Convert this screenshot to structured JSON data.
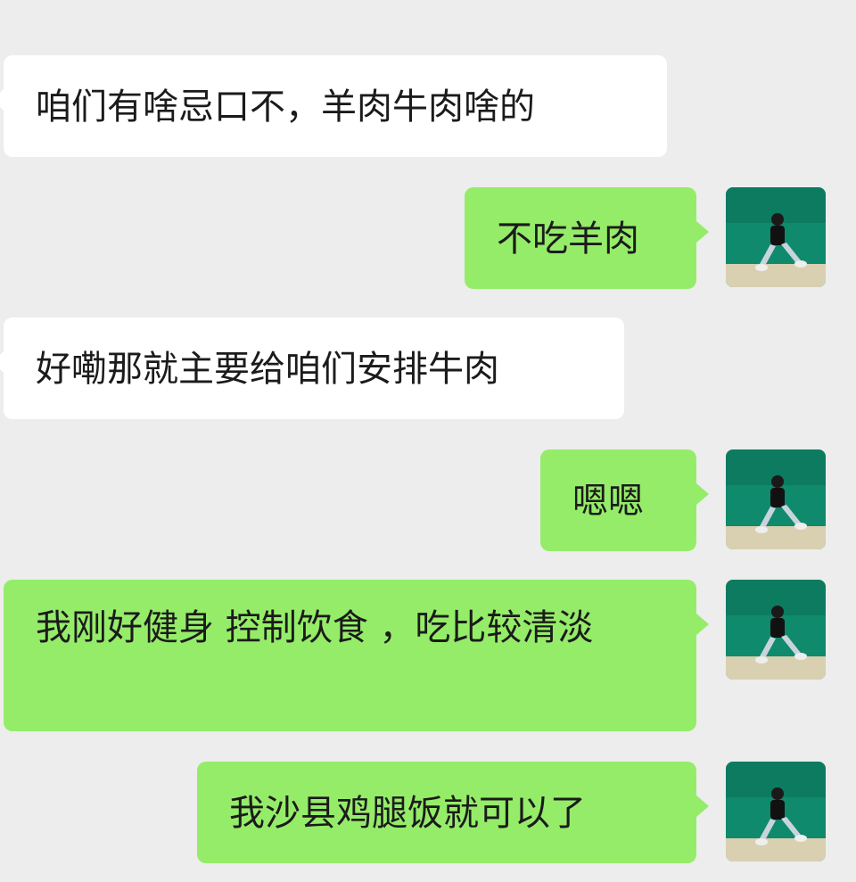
{
  "messages": [
    {
      "side": "in",
      "text": "咱们有啥忌口不，羊肉牛肉啥的"
    },
    {
      "side": "out",
      "text": "不吃羊肉"
    },
    {
      "side": "in",
      "text": "好嘞那就主要给咱们安排牛肉"
    },
    {
      "side": "out",
      "text": "嗯嗯"
    },
    {
      "side": "out",
      "text": "我刚好健身 控制饮食 ，吃比较清淡"
    },
    {
      "side": "out",
      "text": "我沙县鸡腿饭就可以了"
    }
  ],
  "colors": {
    "background": "#ededed",
    "incoming_bubble": "#ffffff",
    "outgoing_bubble": "#95ec69",
    "text": "#1b1b1b",
    "avatar_wall": "#0f8a6c",
    "avatar_floor": "#d8d0b0"
  }
}
